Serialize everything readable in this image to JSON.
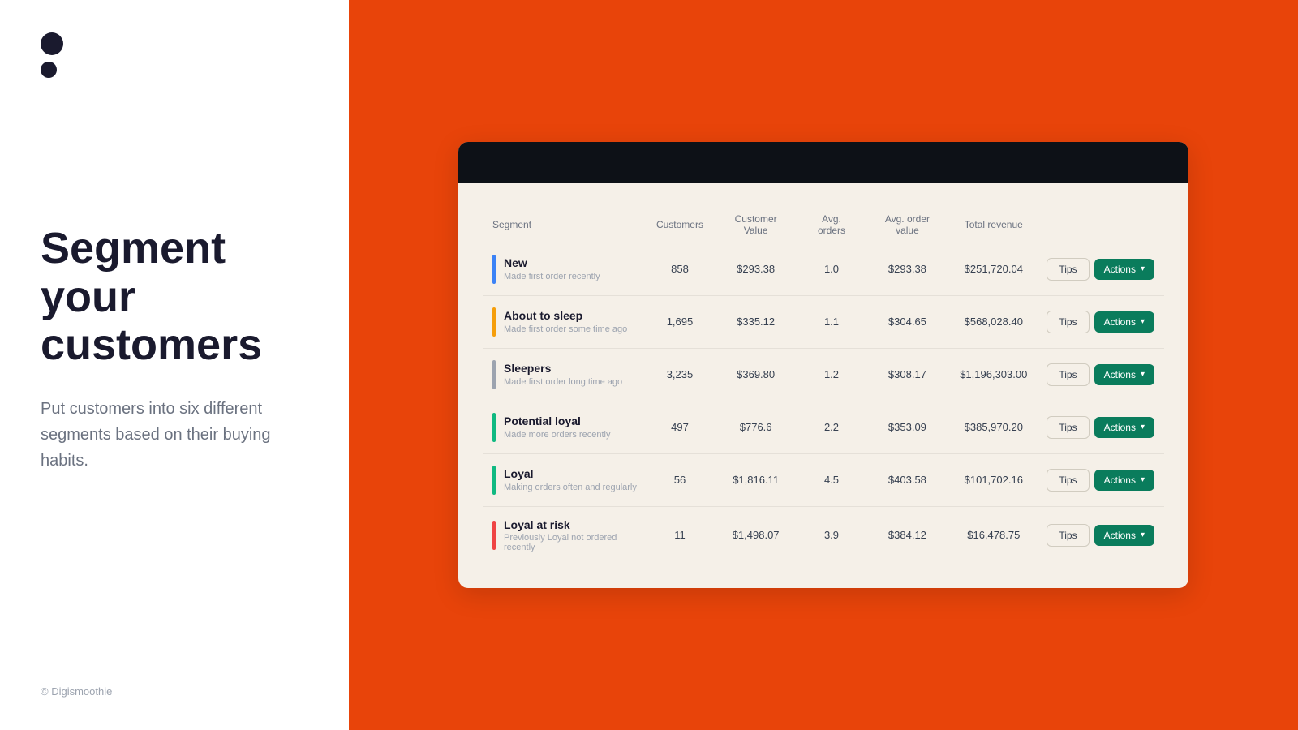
{
  "left": {
    "logo_dots": [
      {
        "size": "large"
      },
      {
        "size": "small"
      }
    ],
    "heading": "Segment your customers",
    "subtext": "Put customers into six different segments based on their buying habits.",
    "copyright": "© Digismoothie"
  },
  "table": {
    "columns": [
      "Segment",
      "Customers",
      "Customer Value",
      "Avg. orders",
      "Avg. order value",
      "Total revenue",
      ""
    ],
    "rows": [
      {
        "color": "#3b82f6",
        "name": "New",
        "desc": "Made first order recently",
        "customers": "858",
        "customer_value": "$293.38",
        "avg_orders": "1.0",
        "avg_order_value": "$293.38",
        "total_revenue": "$251,720.04"
      },
      {
        "color": "#f59e0b",
        "name": "About to sleep",
        "desc": "Made first order some time ago",
        "customers": "1,695",
        "customer_value": "$335.12",
        "avg_orders": "1.1",
        "avg_order_value": "$304.65",
        "total_revenue": "$568,028.40"
      },
      {
        "color": "#9ca3af",
        "name": "Sleepers",
        "desc": "Made first order long time ago",
        "customers": "3,235",
        "customer_value": "$369.80",
        "avg_orders": "1.2",
        "avg_order_value": "$308.17",
        "total_revenue": "$1,196,303.00"
      },
      {
        "color": "#10b981",
        "name": "Potential loyal",
        "desc": "Made more orders recently",
        "customers": "497",
        "customer_value": "$776.6",
        "avg_orders": "2.2",
        "avg_order_value": "$353.09",
        "total_revenue": "$385,970.20"
      },
      {
        "color": "#10b981",
        "name": "Loyal",
        "desc": "Making orders often and regularly",
        "customers": "56",
        "customer_value": "$1,816.11",
        "avg_orders": "4.5",
        "avg_order_value": "$403.58",
        "total_revenue": "$101,702.16"
      },
      {
        "color": "#ef4444",
        "name": "Loyal at risk",
        "desc": "Previously Loyal not ordered recently",
        "customers": "11",
        "customer_value": "$1,498.07",
        "avg_orders": "3.9",
        "avg_order_value": "$384.12",
        "total_revenue": "$16,478.75"
      }
    ],
    "tips_label": "Tips",
    "actions_label": "Actions"
  }
}
